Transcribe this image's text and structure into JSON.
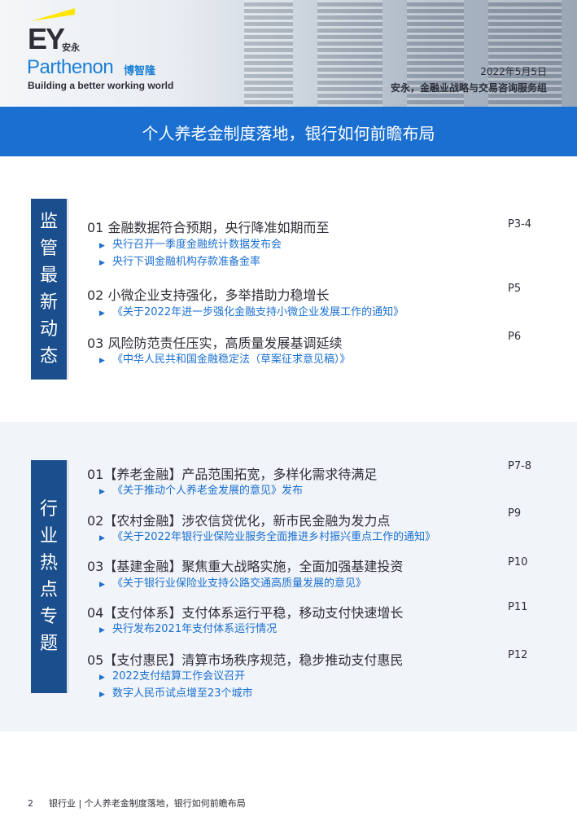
{
  "header": {
    "logo_ey": "EY",
    "logo_ey_cn": "安永",
    "logo_parthenon": "Parthenon",
    "logo_parthenon_cn": "博智隆",
    "tagline": "Building a better working world",
    "date": "2022年5月5日",
    "org": "安永，金融业战略与交易咨询服务组",
    "title": "个人养老金制度落地，银行如何前瞻布局"
  },
  "sections": [
    {
      "label": [
        "监",
        "管",
        "最",
        "新",
        "动",
        "态"
      ],
      "items": [
        {
          "title": "01 金融数据符合预期，央行降准如期而至",
          "page": "P3-4",
          "subs": [
            "央行召开一季度金融统计数据发布会",
            "央行下调金融机构存款准备金率"
          ]
        },
        {
          "title": "02 小微企业支持强化，多举措助力稳增长",
          "page": "P5",
          "subs": [
            "《关于2022年进一步强化金融支持小微企业发展工作的通知》"
          ]
        },
        {
          "title": "03 风险防范责任压实，高质量发展基调延续",
          "page": "P6",
          "subs": [
            "《中华人民共和国金融稳定法（草案征求意见稿）》"
          ]
        }
      ]
    },
    {
      "label": [
        "行",
        "业",
        "热",
        "点",
        "专",
        "题"
      ],
      "items": [
        {
          "title": "01【养老金融】产品范围拓宽，多样化需求待满足",
          "page": "P7-8",
          "subs": [
            "《关于推动个人养老金发展的意见》发布"
          ]
        },
        {
          "title": "02【农村金融】涉农信贷优化，新市民金融为发力点",
          "page": "P9",
          "subs": [
            "《关于2022年银行业保险业服务全面推进乡村振兴重点工作的通知》"
          ]
        },
        {
          "title": "03【基建金融】聚焦重大战略实施，全面加强基建投资",
          "page": "P10",
          "subs": [
            "《关于银行业保险业支持公路交通高质量发展的意见》"
          ]
        },
        {
          "title": "04【支付体系】支付体系运行平稳，移动支付快速增长",
          "page": "P11",
          "subs": [
            "央行发布2021年支付体系运行情况"
          ]
        },
        {
          "title": "05【支付惠民】清算市场秩序规范，稳步推动支付惠民",
          "page": "P12",
          "subs": [
            "2022支付结算工作会议召开",
            "数字人民币试点增至23个城市"
          ]
        }
      ]
    }
  ],
  "footer": {
    "page_number": "2",
    "text": "银行业 | 个人养老金制度落地，银行如何前瞻布局"
  },
  "icons": {
    "bullet": "triangle-right-icon"
  },
  "colors": {
    "brand_blue": "#1a6fd0",
    "navy": "#1a4e8c",
    "ey_yellow": "#ffe600"
  }
}
